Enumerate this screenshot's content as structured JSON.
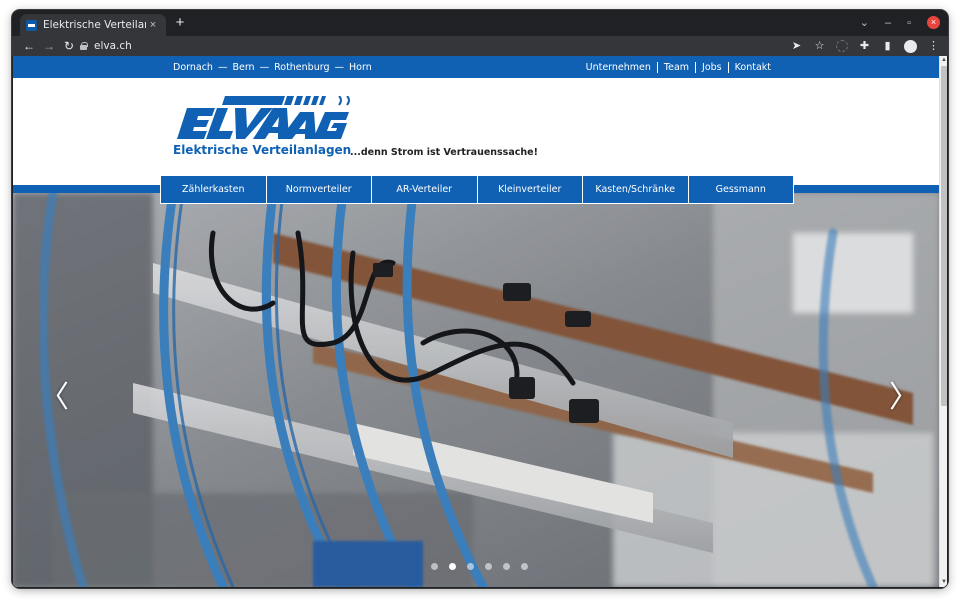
{
  "browser": {
    "tab_title": "Elektrische Verteilanlagen",
    "tab_close": "×",
    "new_tab": "+",
    "url": "elva.ch",
    "controls": {
      "minimize": "–",
      "maximize": "▫",
      "close": "×",
      "dropdown": "⌄"
    }
  },
  "topbar": {
    "locations": [
      "Dornach",
      "Bern",
      "Rothenburg",
      "Horn"
    ],
    "separator": "—",
    "links": [
      "Unternehmen",
      "Team",
      "Jobs",
      "Kontakt"
    ]
  },
  "brand": {
    "logo_text": "ELVA AG",
    "subtitle": "Elektrische Verteilanlagen",
    "tagline": "...denn Strom ist Vertrauenssache!",
    "color": "#1061b4"
  },
  "mainnav": {
    "items": [
      "Zählerkasten",
      "Normverteiler",
      "AR-Verteiler",
      "Kleinverteiler",
      "Kasten/Schränke",
      "Gessmann"
    ]
  },
  "slider": {
    "prev": "〈",
    "next": "〉",
    "slide_count": 6,
    "active_index": 1
  },
  "colors": {
    "brand_blue": "#1061b4",
    "browser_dark": "#202124",
    "browser_toolbar": "#35363a"
  }
}
